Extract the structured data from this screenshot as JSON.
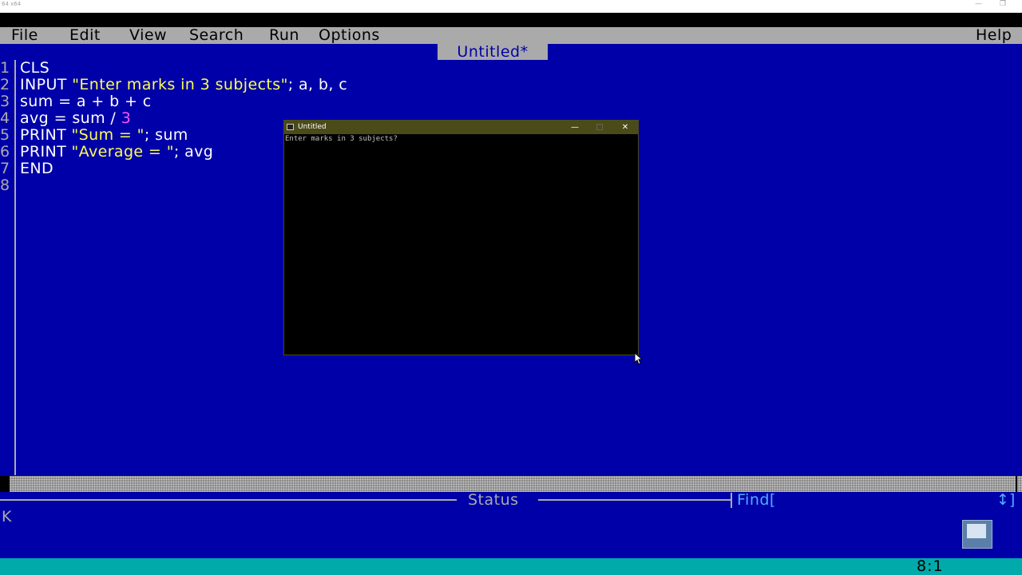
{
  "host": {
    "title": "64 x64",
    "minimize": "—",
    "restore": "❐"
  },
  "menu": {
    "items": [
      "File",
      "Edit",
      "View",
      "Search",
      "Run",
      "Options"
    ],
    "help": "Help"
  },
  "editor": {
    "title": "Untitled*",
    "lines": [
      {
        "num": "1",
        "parts": [
          {
            "t": "CLS",
            "c": "kw"
          }
        ]
      },
      {
        "num": "2",
        "parts": [
          {
            "t": "INPUT ",
            "c": "kw"
          },
          {
            "t": "\"Enter marks in 3 subjects\"",
            "c": "str"
          },
          {
            "t": "; a, b, c",
            "c": "txt"
          }
        ]
      },
      {
        "num": "3",
        "parts": [
          {
            "t": "sum = a + b + c",
            "c": "txt"
          }
        ]
      },
      {
        "num": "4",
        "parts": [
          {
            "t": "avg = sum / ",
            "c": "txt"
          },
          {
            "t": "3",
            "c": "num"
          }
        ]
      },
      {
        "num": "5",
        "parts": [
          {
            "t": "PRINT ",
            "c": "kw"
          },
          {
            "t": "\"Sum = \"",
            "c": "str"
          },
          {
            "t": "; sum",
            "c": "txt"
          }
        ]
      },
      {
        "num": "6",
        "parts": [
          {
            "t": "PRINT ",
            "c": "kw"
          },
          {
            "t": "\"Average = \"",
            "c": "str"
          },
          {
            "t": "; avg",
            "c": "txt"
          }
        ]
      },
      {
        "num": "7",
        "parts": [
          {
            "t": "END",
            "c": "kw"
          }
        ]
      },
      {
        "num": "8",
        "parts": []
      }
    ]
  },
  "status": {
    "label": "Status",
    "find_label": "Find[",
    "find_arrows": "↕]",
    "text": "K"
  },
  "cursor_position": "8:1",
  "console": {
    "title": "Untitled",
    "minimize": "—",
    "maximize": "□",
    "close": "✕",
    "output": "Enter marks in 3 subjects?"
  },
  "colors": {
    "background": "#0000a8",
    "menu": "#aaaaaa",
    "string": "#ffff55",
    "number": "#ff55ff",
    "bottom_bar": "#00aaaa",
    "console_title": "#4b4b1a"
  }
}
